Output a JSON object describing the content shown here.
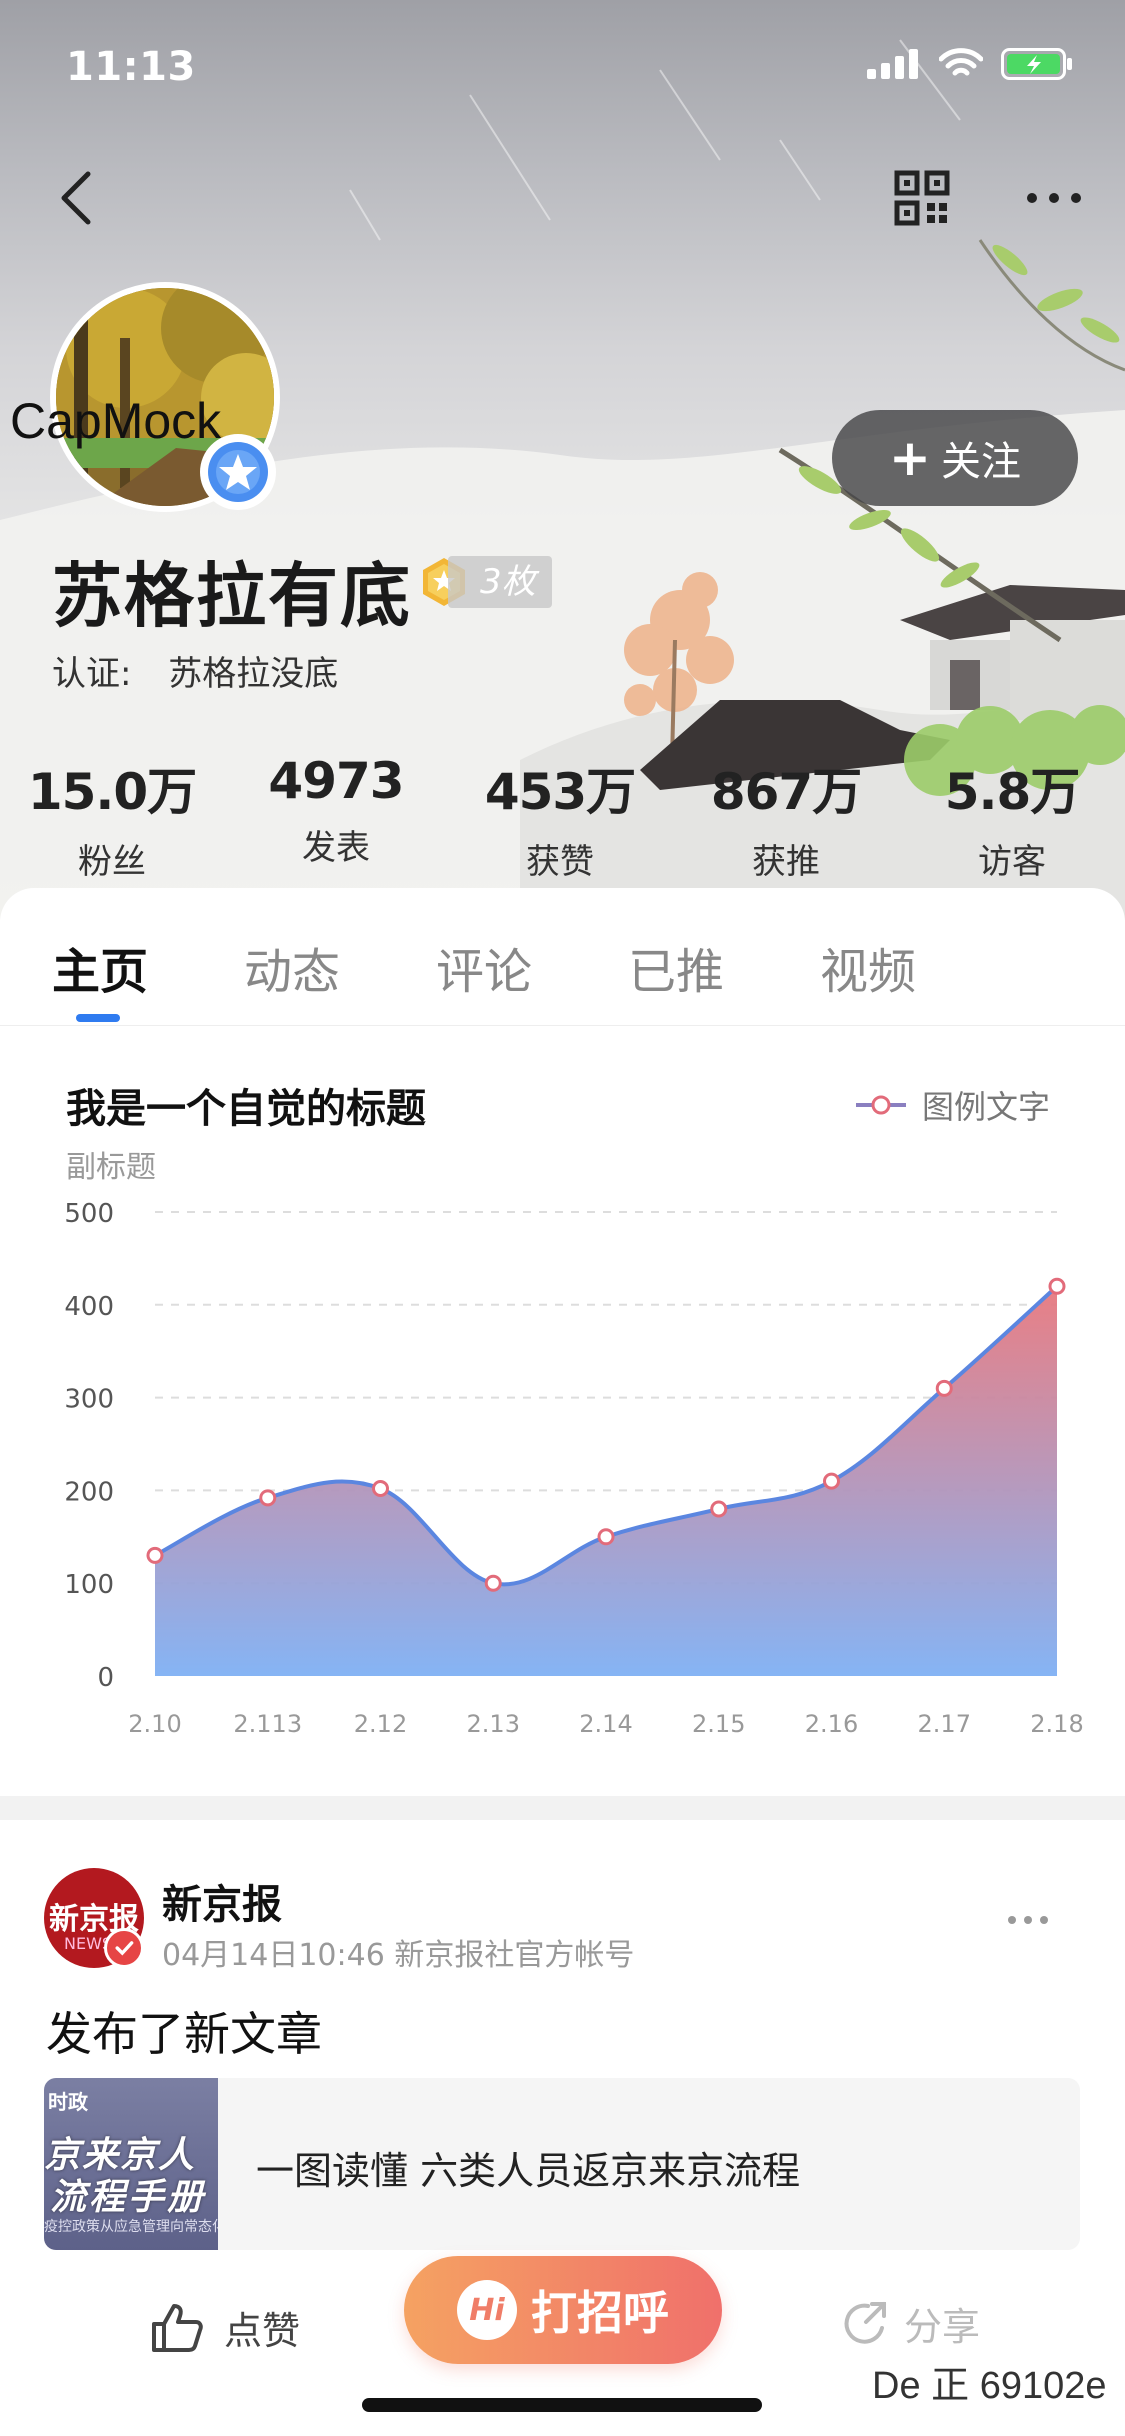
{
  "status_bar": {
    "time": "11:13"
  },
  "profile": {
    "avatar_label": "CapMock",
    "name": "苏格拉有底",
    "medal_count": "3枚",
    "cert_label": "认证:",
    "cert_value": "苏格拉没底",
    "follow_label": "关注"
  },
  "stats": [
    {
      "value": "15.0万",
      "label": "粉丝"
    },
    {
      "value": "4973",
      "label": "发表"
    },
    {
      "value": "453万",
      "label": "获赞"
    },
    {
      "value": "867万",
      "label": "获推"
    },
    {
      "value": "5.8万",
      "label": "访客"
    }
  ],
  "tabs": [
    "主页",
    "动态",
    "评论",
    "已推",
    "视频"
  ],
  "chart_data": {
    "type": "area",
    "title": "我是一个自觉的标题",
    "subtitle": "副标题",
    "legend": "图例文字",
    "legend_position": "top-right",
    "categories": [
      "2.10",
      "2.113",
      "2.12",
      "2.13",
      "2.14",
      "2.15",
      "2.16",
      "2.17",
      "2.18"
    ],
    "values": [
      130,
      192,
      202,
      100,
      150,
      180,
      210,
      310,
      420
    ],
    "y_ticks": [
      "0",
      "100",
      "200",
      "300",
      "400",
      "500"
    ],
    "ylim": [
      0,
      500
    ],
    "grid": true,
    "colors": {
      "line": "#5b86e0",
      "marker": "#e26b7a",
      "fill_top": "#e8787e",
      "fill_bottom": "#7fb0f4"
    }
  },
  "feed": {
    "author": "新京报",
    "avatar_text": "新京报",
    "avatar_sub": "NEWS",
    "meta": "04月14日10:46 新京报社官方帐号",
    "text": "发布了新文章",
    "thumb_tag": "时政",
    "thumb_line1": "京来京人",
    "thumb_line2": "流程手册",
    "thumb_small": "疫控政策从应急管理向常态化转变 下对于各类来京人员",
    "article_title": "一图读懂 六类人员返京来京流程"
  },
  "actions": {
    "like": "点赞",
    "hi_badge": "Hi",
    "greet": "打招呼",
    "share": "分享"
  },
  "watermark": "De 正 69102e"
}
